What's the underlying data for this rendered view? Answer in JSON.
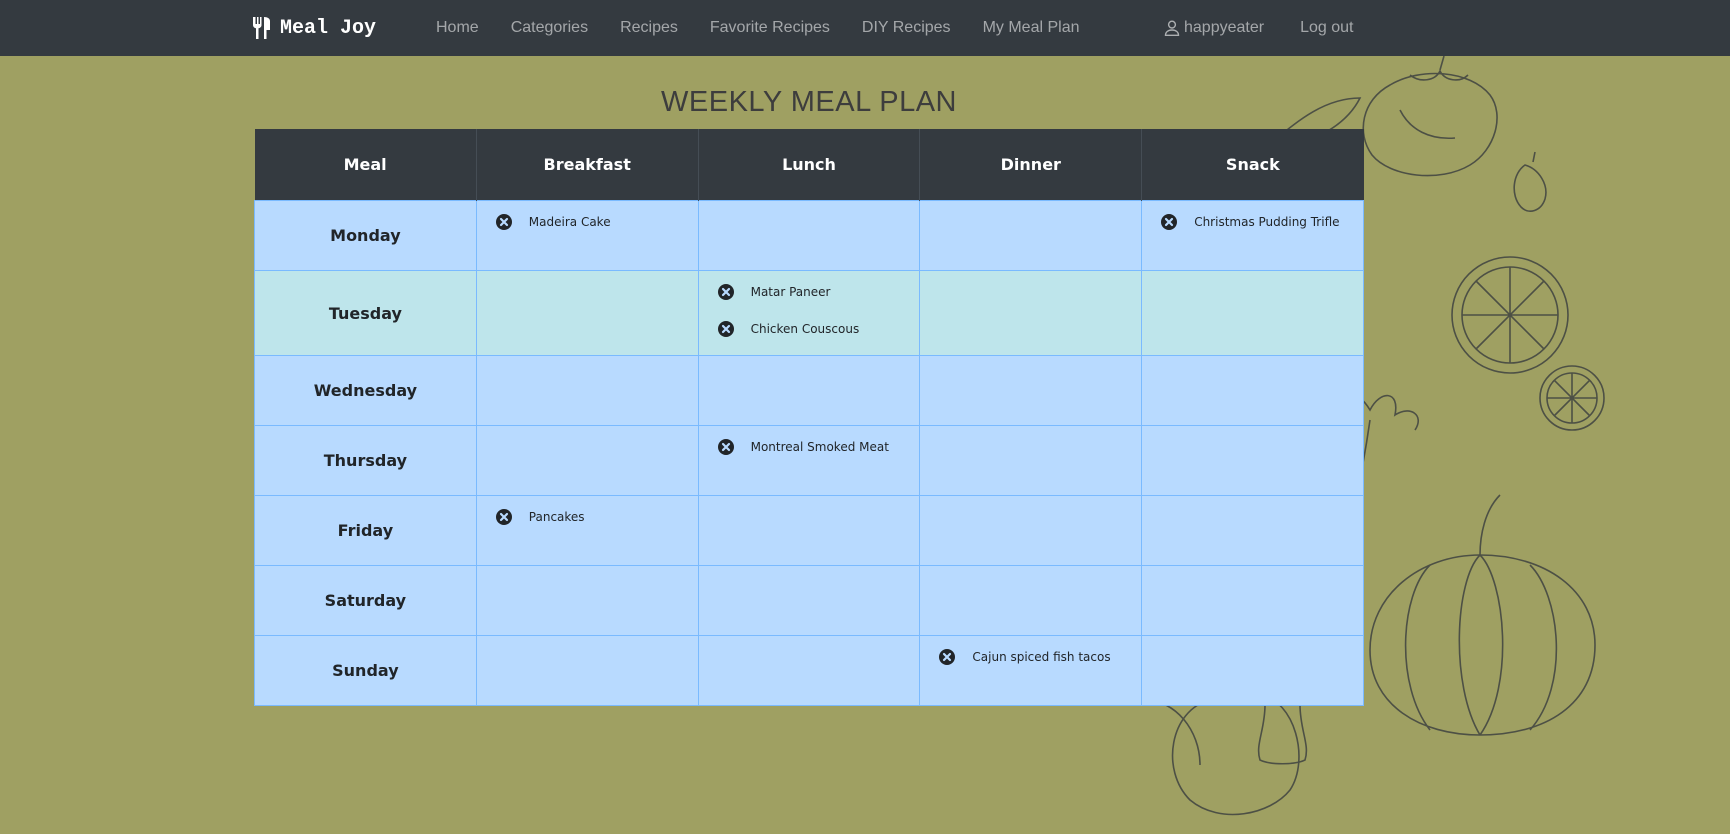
{
  "brand": {
    "name": "Meal Joy",
    "icon": "utensils-icon"
  },
  "nav": {
    "links": [
      "Home",
      "Categories",
      "Recipes",
      "Favorite Recipes",
      "DIY Recipes",
      "My Meal Plan"
    ],
    "user": {
      "icon": "user-icon",
      "name": "happyeater"
    },
    "logout": "Log out"
  },
  "page": {
    "title": "WEEKLY MEAL PLAN"
  },
  "table": {
    "headers": [
      "Meal",
      "Breakfast",
      "Lunch",
      "Dinner",
      "Snack"
    ],
    "rows": [
      {
        "day": "Monday",
        "breakfast": [
          "Madeira Cake"
        ],
        "lunch": [],
        "dinner": [],
        "snack": [
          "Christmas Pudding Trifle"
        ]
      },
      {
        "day": "Tuesday",
        "breakfast": [],
        "lunch": [
          "Matar Paneer",
          "Chicken Couscous"
        ],
        "dinner": [],
        "snack": []
      },
      {
        "day": "Wednesday",
        "breakfast": [],
        "lunch": [],
        "dinner": [],
        "snack": []
      },
      {
        "day": "Thursday",
        "breakfast": [],
        "lunch": [
          "Montreal Smoked Meat"
        ],
        "dinner": [],
        "snack": []
      },
      {
        "day": "Friday",
        "breakfast": [
          "Pancakes"
        ],
        "lunch": [],
        "dinner": [],
        "snack": []
      },
      {
        "day": "Saturday",
        "breakfast": [],
        "lunch": [],
        "dinner": [],
        "snack": []
      },
      {
        "day": "Sunday",
        "breakfast": [],
        "lunch": [],
        "dinner": [
          "Cajun spiced fish tacos"
        ],
        "snack": []
      }
    ],
    "remove_icon": "times-circle-icon"
  },
  "colors": {
    "background": "#9fa062",
    "navbar": "#343a40",
    "cell": "#b8daff",
    "highlight_row": "#bee5eb",
    "cell_border": "#7abaff"
  }
}
